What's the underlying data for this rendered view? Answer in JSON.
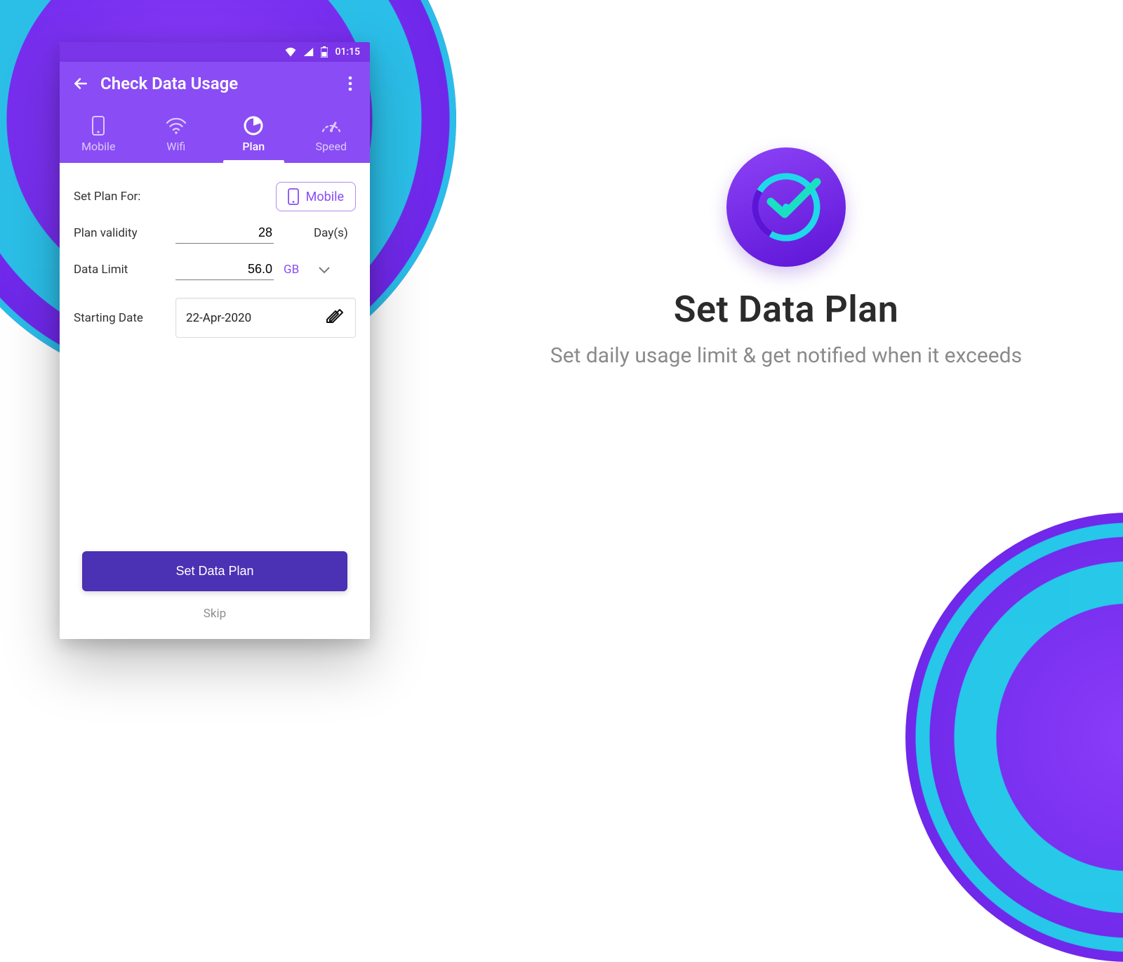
{
  "status_bar": {
    "time": "01:15"
  },
  "app_bar": {
    "title": "Check Data Usage"
  },
  "tabs": [
    {
      "label": "Mobile"
    },
    {
      "label": "Wifi"
    },
    {
      "label": "Plan"
    },
    {
      "label": "Speed"
    }
  ],
  "plan_form": {
    "set_plan_for_label": "Set Plan For:",
    "plan_target": "Mobile",
    "validity_label": "Plan validity",
    "validity_value": "28",
    "validity_unit": "Day(s)",
    "data_limit_label": "Data Limit",
    "data_limit_value": "56.0",
    "data_limit_unit": "GB",
    "start_date_label": "Starting Date",
    "start_date_value": "22-Apr-2020"
  },
  "buttons": {
    "primary": "Set Data Plan",
    "skip": "Skip"
  },
  "promo": {
    "title": "Set Data Plan",
    "subtitle": "Set daily usage limit & get notified when it exceeds"
  }
}
